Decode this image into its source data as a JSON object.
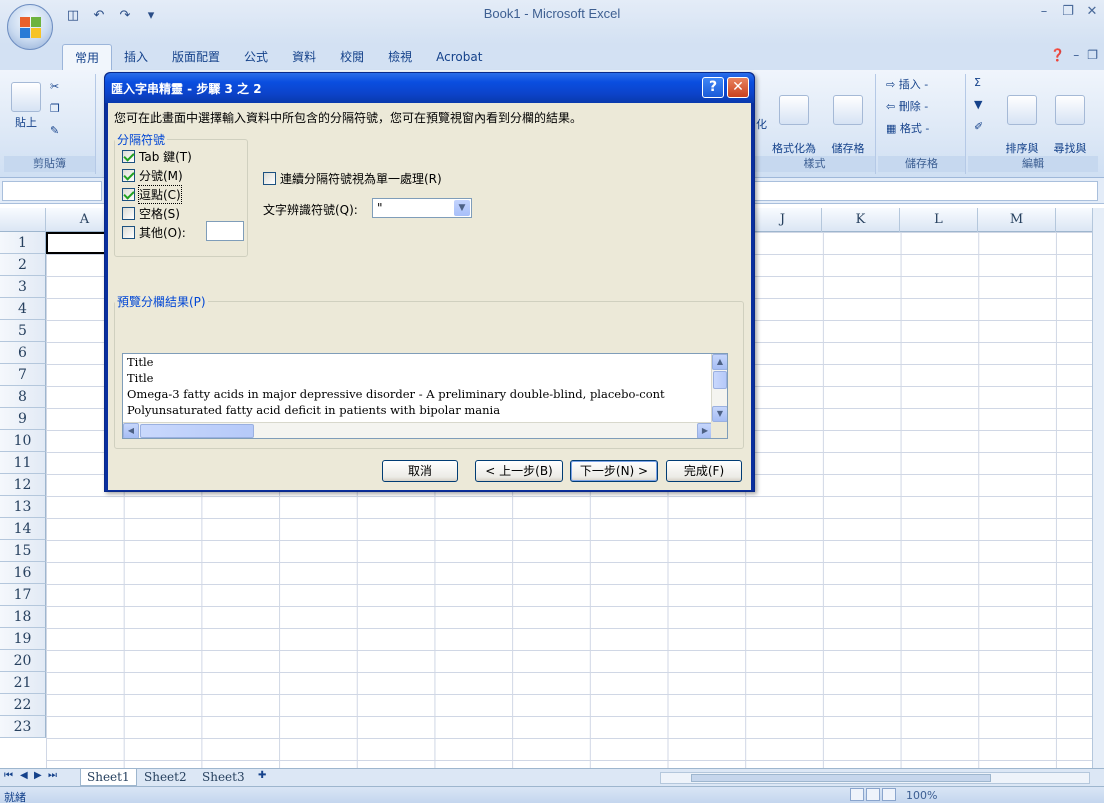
{
  "app": {
    "title": "Book1 - Microsoft Excel",
    "qat_icons": [
      "save-icon",
      "undo-icon",
      "redo-icon",
      "customize-icon"
    ]
  },
  "ribbon": {
    "tabs": [
      "常用",
      "插入",
      "版面配置",
      "公式",
      "資料",
      "校閱",
      "檢視",
      "Acrobat"
    ],
    "active_tab": "常用",
    "clipboard": {
      "paste_label": "貼上",
      "group_label": "剪貼簿"
    },
    "styles": {
      "cond_format": "化",
      "format_table": "格式化為\n表格 -",
      "cell_styles": "儲存格\n樣式 -",
      "group_label": "樣式"
    },
    "cells": {
      "insert": "插入 -",
      "delete": "刪除 -",
      "format": "格式 -",
      "group_label": "儲存格"
    },
    "editing": {
      "sort_filter": "排序與\n篩選 -",
      "find_select": "尋找與\n選取 -",
      "group_label": "編輯"
    }
  },
  "grid": {
    "columns": [
      "A",
      "J",
      "K",
      "L",
      "M"
    ],
    "rows": [
      "1",
      "2",
      "3",
      "4",
      "5",
      "6",
      "7",
      "8",
      "9",
      "10",
      "11",
      "12",
      "13",
      "14",
      "15",
      "16",
      "17",
      "18",
      "19",
      "20",
      "21",
      "22",
      "23"
    ]
  },
  "sheets": {
    "tabs": [
      "Sheet1",
      "Sheet2",
      "Sheet3"
    ],
    "active": "Sheet1"
  },
  "status": {
    "ready": "就緒",
    "zoom": "100%"
  },
  "dialog": {
    "title": "匯入字串精靈 - 步驟 3 之 2",
    "instruction": "您可在此畫面中選擇輸入資料中所包含的分隔符號，您可在預覽視窗內看到分欄的結果。",
    "delimiters_legend": "分隔符號",
    "delimiters": [
      {
        "label": "Tab 鍵(T)",
        "checked": true
      },
      {
        "label": "分號(M)",
        "checked": true
      },
      {
        "label": "逗點(C)",
        "checked": true
      },
      {
        "label": "空格(S)",
        "checked": false
      },
      {
        "label": "其他(O):",
        "checked": false
      }
    ],
    "consecutive": {
      "label": "連續分隔符號視為單一處理(R)",
      "checked": false
    },
    "qualifier": {
      "label": "文字辨識符號(Q):",
      "value": "\""
    },
    "preview_legend": "預覽分欄結果(P)",
    "preview_lines": [
      "Title",
      "Title",
      "Omega-3 fatty acids in major depressive disorder - A preliminary double-blind, placebo-cont",
      "Polyunsaturated fatty acid deficit in patients with bipolar mania"
    ],
    "buttons": {
      "cancel": "取消",
      "back": "< 上一步(B)",
      "next": "下一步(N) >",
      "finish": "完成(F)"
    }
  }
}
